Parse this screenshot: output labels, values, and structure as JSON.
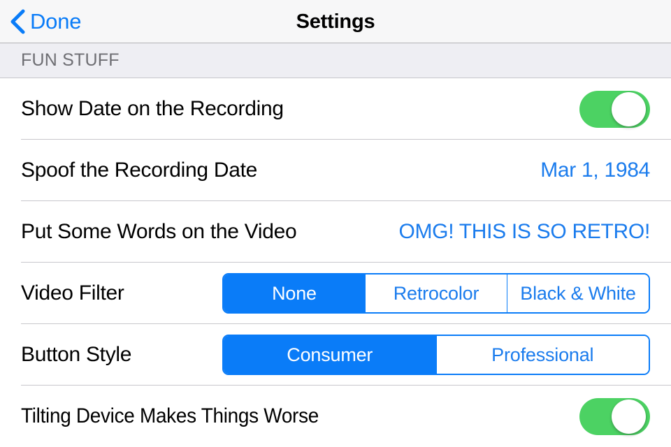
{
  "navbar": {
    "back_label": "Done",
    "back_icon": "chevron-left-icon",
    "title": "Settings"
  },
  "section": {
    "header": "FUN STUFF"
  },
  "colors": {
    "accent_blue": "#0a7cf8",
    "text_blue": "#1b7ced",
    "switch_on_green": "#4cd263",
    "separator": "#c8c7cc",
    "header_bg": "#eeeef3",
    "navbar_bg": "#f7f7f8"
  },
  "rows": [
    {
      "label": "Show Date on the Recording",
      "control": "switch",
      "value": "on"
    },
    {
      "label": "Spoof the Recording Date",
      "control": "value",
      "value": "Mar 1, 1984"
    },
    {
      "label": "Put Some Words on the Video",
      "control": "value",
      "value": "OMG! THIS IS SO RETRO!"
    },
    {
      "label": "Video Filter",
      "control": "segmented",
      "options": [
        "None",
        "Retrocolor",
        "Black & White"
      ],
      "selected": "None"
    },
    {
      "label": "Button Style",
      "control": "segmented",
      "options": [
        "Consumer",
        "Professional"
      ],
      "selected": "Consumer"
    },
    {
      "label": "Tilting Device Makes Things Worse",
      "control": "switch",
      "value": "on"
    }
  ]
}
